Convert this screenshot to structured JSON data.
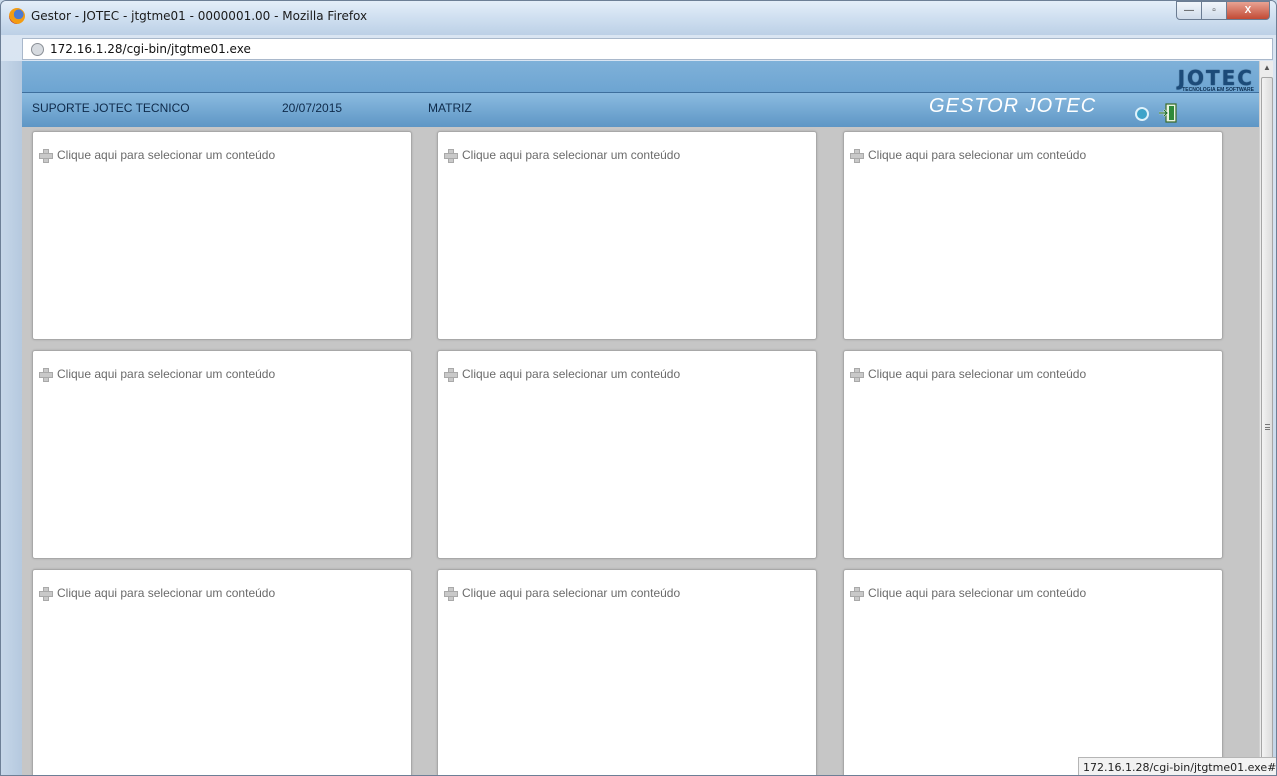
{
  "window": {
    "title": "Gestor - JOTEC - jtgtme01 - 0000001.00 - Mozilla Firefox",
    "minimize": "—",
    "maximize": "▫",
    "close": "X"
  },
  "address_bar": {
    "url": "172.16.1.28/cgi-bin/jtgtme01.exe"
  },
  "header": {
    "user": "SUPORTE JOTEC TECNICO",
    "date": "20/07/2015",
    "branch": "MATRIZ",
    "app_title": "GESTOR JOTEC",
    "logo_text": "JOTEC",
    "logo_subtext": "TECNOLOGIA EM SOFTWARE",
    "icons": [
      "refresh-icon",
      "exit-icon"
    ]
  },
  "panels": [
    {
      "label": "Clique aqui para selecionar um conteúdo"
    },
    {
      "label": "Clique aqui para selecionar um conteúdo"
    },
    {
      "label": "Clique aqui para selecionar um conteúdo"
    },
    {
      "label": "Clique aqui para selecionar um conteúdo"
    },
    {
      "label": "Clique aqui para selecionar um conteúdo"
    },
    {
      "label": "Clique aqui para selecionar um conteúdo"
    },
    {
      "label": "Clique aqui para selecionar um conteúdo"
    },
    {
      "label": "Clique aqui para selecionar um conteúdo"
    },
    {
      "label": "Clique aqui para selecionar um conteúdo"
    }
  ],
  "status_bar": {
    "link_preview": "172.16.1.28/cgi-bin/jtgtme01.exe#"
  },
  "colors": {
    "header_blue": "#6ea5d2",
    "panel_bg": "#ffffff",
    "workspace_bg": "#c6c6c6"
  }
}
